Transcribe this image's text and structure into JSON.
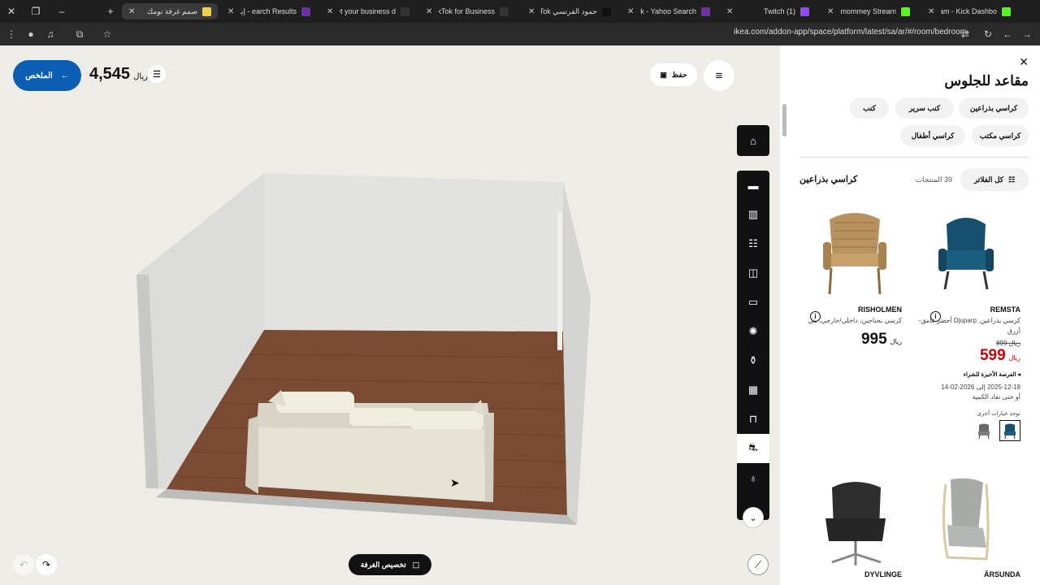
{
  "browser": {
    "tabs": [
      {
        "title": "صمم غرفة نومك",
        "active": true
      },
      {
        "title": "earch Results - إيكيا"
      },
      {
        "title": "Get your business d"
      },
      {
        "title": "TikTok for Business |"
      },
      {
        "title": "حمود الفرنسي TikTok |"
      },
      {
        "title": "TikTok - Yahoo Search"
      },
      {
        "title": "(1) Twitch"
      },
      {
        "title": "lilgmommey Stream"
      },
      {
        "title": "Stream - Kick Dashbo"
      }
    ],
    "url": "ikea.com/addon-app/space/platform/latest/sa/ar/#/room/bedroom"
  },
  "toolbar": {
    "summary_label": "الملخص",
    "total_value": "4,545",
    "currency": "ريال",
    "save_label": "حفظ",
    "customize_room_label": "تخصيص الغرفة"
  },
  "rail_icons": [
    "home-icon",
    "bed-icon",
    "wardrobe-icon",
    "drawers-icon",
    "door-icon",
    "storage-icon",
    "lamp-icon",
    "decor-icon",
    "shelf-icon",
    "table-icon",
    "sofa-icon",
    "vase-icon"
  ],
  "panel": {
    "title": "مقاعد للجلوس",
    "chips": [
      "كراسي بذراعين",
      "كنب سرير",
      "كنب",
      "كراسي مكتب",
      "كراسي أطفال"
    ],
    "filters_label": "كل الفلاتر",
    "count": "39 المنتجات",
    "category_title": "كراسي بذراعين",
    "products": [
      {
        "name": "REMSTA",
        "desc": "كرسي بذراعين, Djuparp أخضر غامق-أزرق",
        "old_price": "899",
        "old_currency": "ريال",
        "price": "599",
        "currency": "ريال",
        "last_chance": "الفرصة الأخيرة للشراء",
        "dates": "2025-12-18 إلى 2026-02-14",
        "dates_note": "أو حتى نفاد الكمية",
        "other_options": "توجد خيارات أخرى"
      },
      {
        "name": "RISHOLMEN",
        "desc": "كرسي بجناحين، داخلي/خارجي، بني",
        "price": "995",
        "currency": "ريال"
      },
      {
        "name": "ÄRSUNDA"
      },
      {
        "name": "DYVLINGE"
      }
    ]
  },
  "colors": {
    "accent_blue": "#0a5fb4",
    "sale_red": "#cc0008",
    "rail_black": "#111111"
  }
}
